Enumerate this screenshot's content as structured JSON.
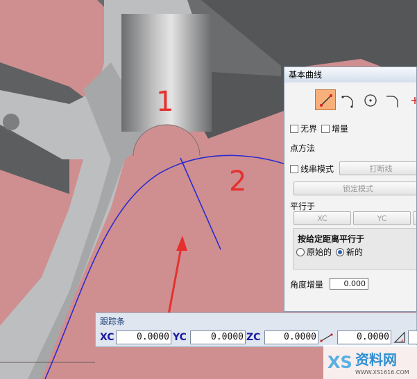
{
  "dialog": {
    "title": "基本曲线",
    "tools": [
      "line-icon",
      "arc-icon",
      "circle-icon",
      "fillet-icon"
    ],
    "infinite_label": "无界",
    "increment_label": "增量",
    "point_method_label": "点方法",
    "string_mode_label": "线串模式",
    "break_string_label": "打断线",
    "lock_mode_label": "锁定模式",
    "parallel_to_label": "平行于",
    "xc_button": "XC",
    "yc_button": "YC",
    "distance_group_title": "按给定距离平行于",
    "original_label": "原始的",
    "new_label": "新的",
    "angle_increment_label": "角度增量",
    "angle_increment_value": "0.000"
  },
  "trackbar": {
    "title": "跟踪条",
    "xc_label": "XC",
    "xc_value": "0.0000",
    "yc_label": "YC",
    "yc_value": "0.0000",
    "zc_label": "ZC",
    "zc_value": "0.0000",
    "length_value": "0.0000"
  },
  "annotations": {
    "label_1": "1",
    "label_2": "2"
  },
  "watermark": {
    "name": "资料网",
    "url": "WWW.XS1616.COM",
    "logo": "XS"
  },
  "colors": {
    "background": "#cf8f90",
    "annotation": "#e5312e",
    "curve": "#2b2bd0"
  }
}
